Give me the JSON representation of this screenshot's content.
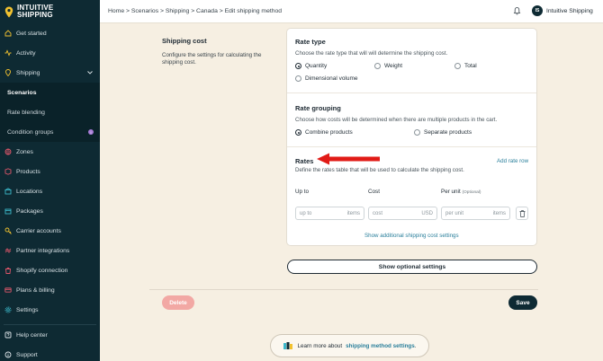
{
  "brand": {
    "line1": "INTUITIVE",
    "line2": "SHIPPING"
  },
  "sidebar": {
    "items_top": [
      {
        "label": "Get started",
        "icon": "home-icon"
      },
      {
        "label": "Activity",
        "icon": "activity-icon"
      },
      {
        "label": "Shipping",
        "icon": "shipping-icon"
      }
    ],
    "sub_items": [
      {
        "label": "Scenarios",
        "active": true
      },
      {
        "label": "Rate blending",
        "active": false
      },
      {
        "label": "Condition groups",
        "badge": "i"
      }
    ],
    "items_bottom": [
      {
        "label": "Zones",
        "icon": "zones-icon"
      },
      {
        "label": "Products",
        "icon": "products-icon"
      },
      {
        "label": "Locations",
        "icon": "locations-icon"
      },
      {
        "label": "Packages",
        "icon": "packages-icon"
      },
      {
        "label": "Carrier accounts",
        "icon": "carrier-icon"
      },
      {
        "label": "Partner integrations",
        "icon": "integrations-icon"
      },
      {
        "label": "Shopify connection",
        "icon": "shopify-icon"
      },
      {
        "label": "Plans & billing",
        "icon": "billing-icon"
      },
      {
        "label": "Settings",
        "icon": "settings-icon"
      }
    ],
    "items_footer": [
      {
        "label": "Help center",
        "icon": "help-icon"
      },
      {
        "label": "Support",
        "icon": "support-icon"
      }
    ]
  },
  "topbar": {
    "breadcrumb": "Home > Scenarios > Shipping > Canada > Edit shipping method",
    "user_initials": "IS",
    "user_name": "Intuitive Shipping"
  },
  "section": {
    "title": "Shipping cost",
    "description": "Configure the settings for calculating the shipping cost."
  },
  "rate_type": {
    "title": "Rate type",
    "description": "Choose the rate type that will will determine the shipping cost.",
    "options": [
      "Quantity",
      "Weight",
      "Total",
      "Dimensional volume"
    ],
    "selected": "Quantity"
  },
  "rate_grouping": {
    "title": "Rate grouping",
    "description": "Choose how costs will be determined when there are multiple products in the cart.",
    "options": [
      "Combine products",
      "Separate products"
    ],
    "selected": "Combine products"
  },
  "rates": {
    "title": "Rates",
    "description": "Define the rates table that will be used to calculate the shipping cost.",
    "add_row": "Add rate row",
    "columns": {
      "up_to": "Up to",
      "cost": "Cost",
      "per_unit": "Per unit",
      "optional": "(Optional)"
    },
    "row": {
      "up_to_placeholder": "up to",
      "up_to_unit": "items",
      "cost_placeholder": "cost",
      "cost_unit": "USD",
      "per_unit_placeholder": "per unit",
      "per_unit_unit": "items"
    },
    "show_additional": "Show additional shipping cost settings"
  },
  "buttons": {
    "show_optional": "Show optional settings",
    "delete": "Delete",
    "save": "Save"
  },
  "learn_more": {
    "prefix": "Learn more about",
    "link": "shipping method settings",
    "suffix": "."
  },
  "colors": {
    "sidebar_bg": "#0e2a33",
    "page_bg": "#f6efe2",
    "accent_link": "#2a7f9b",
    "delete_bg": "#f2a8a4",
    "arrow": "#e11b17"
  }
}
